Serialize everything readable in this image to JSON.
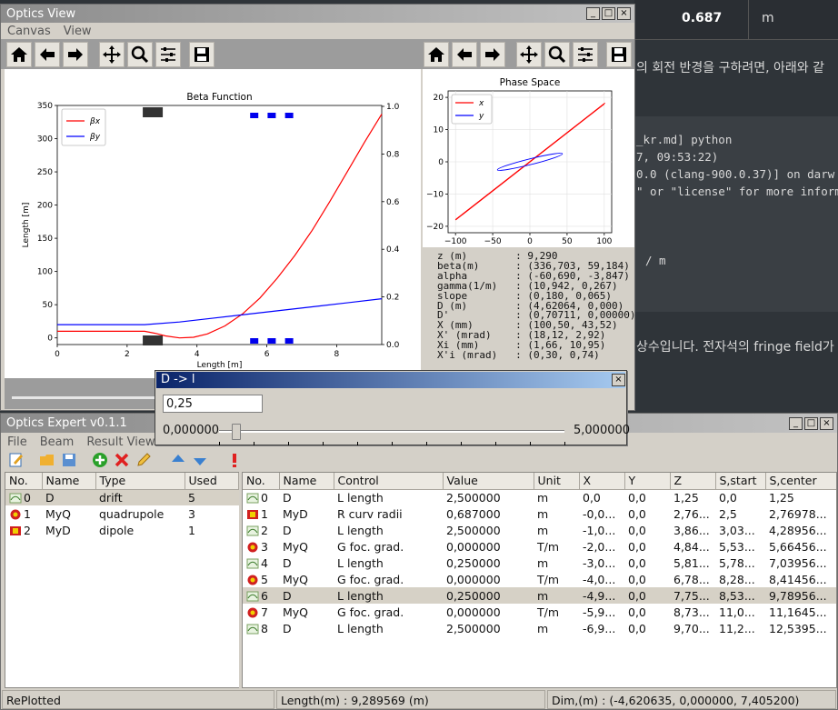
{
  "background": {
    "header_value": "0.687",
    "header_unit": "m",
    "korean_line1": "의 회전 반경을 구하려면, 아래와 같",
    "code_lines": [
      "_kr.md] python",
      "7, 09:53:22)",
      "0.0 (clang-900.0.37)] on darw",
      "\" or \"license\" for more inform"
    ],
    "unit_line": "/ m",
    "korean_line2": "상수입니다. 전자석의 fringe field가"
  },
  "optics_view": {
    "title": "Optics View",
    "menu": [
      "Canvas",
      "View"
    ],
    "beta_chart": {
      "title": "Beta Function",
      "xlabel": "Length [m]",
      "ylabel": "Length [m]",
      "legend": [
        "βx",
        "βy"
      ],
      "x_ticks": [
        "0",
        "2",
        "4",
        "6",
        "8"
      ],
      "y_ticks": [
        "0",
        "50",
        "100",
        "150",
        "200",
        "250",
        "300",
        "350"
      ],
      "y2_ticks": [
        "0.0",
        "0.2",
        "0.4",
        "0.6",
        "0.8",
        "1.0"
      ]
    },
    "phase_chart": {
      "title": "Phase Space",
      "legend": [
        "x",
        "y"
      ],
      "x_ticks": [
        "−100",
        "−50",
        "0",
        "50",
        "100"
      ],
      "y_ticks": [
        "−20",
        "−10",
        "0",
        "10",
        "20"
      ]
    },
    "info_lines": [
      "z (m)        : 9,290",
      "beta(m)      : (336,703, 59,184)",
      "alpha        : (-60,690, -3,847)",
      "gamma(1/m)   : (10,942, 0,267)",
      "slope        : (0,180, 0,065)",
      "D (m)        : (4,62064, 0,000)",
      "D'           : (0,70711, 0,00000)",
      "X (mm)       : (100,50, 43,52)",
      "X' (mrad)    : (18,12, 2,92)",
      "Xi (mm)      : (1,66, 10,95)",
      "X'i (mrad)   : (0,30, 0,74)"
    ]
  },
  "chart_data": [
    {
      "type": "line",
      "title": "Beta Function",
      "xlabel": "Length [m]",
      "ylabel": "Length [m]",
      "xlim": [
        0,
        9.29
      ],
      "ylim": [
        -10,
        350
      ],
      "series": [
        {
          "name": "βx",
          "x": [
            0,
            1,
            2,
            2.5,
            2.8,
            3.1,
            3.5,
            3.9,
            4.3,
            4.8,
            5.3,
            5.8,
            6.3,
            6.8,
            7.3,
            7.8,
            8.3,
            8.8,
            9.29
          ],
          "y": [
            10,
            10,
            10,
            10,
            7,
            3,
            0,
            1,
            6,
            18,
            36,
            60,
            90,
            124,
            162,
            205,
            250,
            295,
            337
          ]
        },
        {
          "name": "βy",
          "x": [
            0,
            2.5,
            3.5,
            4.5,
            5.5,
            6.5,
            7.5,
            8.5,
            9.29
          ],
          "y": [
            20,
            20,
            24,
            30,
            36,
            42,
            48,
            54,
            59
          ]
        }
      ]
    },
    {
      "type": "scatter",
      "title": "Phase Space",
      "xlim": [
        -110,
        110
      ],
      "ylim": [
        -22,
        22
      ],
      "series": [
        {
          "name": "x",
          "x": [
            -100,
            -50,
            0,
            50,
            100
          ],
          "y": [
            -18,
            -9,
            0,
            9,
            18
          ]
        },
        {
          "name": "y",
          "x": [
            -45,
            -20,
            0,
            20,
            44
          ],
          "y": [
            -3,
            -1.5,
            0,
            1.5,
            3
          ]
        }
      ]
    }
  ],
  "dialog": {
    "title": "D -> l",
    "value": "0,25",
    "min_label": "0,000000",
    "max_label": "5,000000",
    "slider_fraction": 0.05
  },
  "expert": {
    "title": "Optics Expert v0.1.1",
    "menu": [
      "File",
      "Beam",
      "Result View"
    ],
    "left_headers": [
      "No.",
      "Name",
      "Type",
      "Used"
    ],
    "left_rows": [
      {
        "no": "0",
        "name": "D",
        "type": "drift",
        "used": "5",
        "icon": "drift-icon"
      },
      {
        "no": "1",
        "name": "MyQ",
        "type": "quadrupole",
        "used": "3",
        "icon": "quadrupole-icon"
      },
      {
        "no": "2",
        "name": "MyD",
        "type": "dipole",
        "used": "1",
        "icon": "dipole-icon"
      }
    ],
    "right_headers": [
      "No.",
      "Name",
      "Control",
      "Value",
      "Unit",
      "X",
      "Y",
      "Z",
      "S,start",
      "S,center"
    ],
    "right_rows": [
      {
        "no": "0",
        "name": "D",
        "control": "L length",
        "value": "2,500000",
        "unit": "m",
        "x": "0,0",
        "y": "0,0",
        "z": "1,25",
        "s_start": "0,0",
        "s_center": "1,25",
        "icon": "drift-icon"
      },
      {
        "no": "1",
        "name": "MyD",
        "control": "R curv radii",
        "value": "0,687000",
        "unit": "m",
        "x": "-0,0...",
        "y": "0,0",
        "z": "2,76...",
        "s_start": "2,5",
        "s_center": "2,76978...",
        "icon": "dipole-icon"
      },
      {
        "no": "2",
        "name": "D",
        "control": "L length",
        "value": "2,500000",
        "unit": "m",
        "x": "-1,0...",
        "y": "0,0",
        "z": "3,86...",
        "s_start": "3,03...",
        "s_center": "4,28956...",
        "icon": "drift-icon"
      },
      {
        "no": "3",
        "name": "MyQ",
        "control": "G foc. grad.",
        "value": "0,000000",
        "unit": "T/m",
        "x": "-2,0...",
        "y": "0,0",
        "z": "4,84...",
        "s_start": "5,53...",
        "s_center": "5,66456...",
        "icon": "quadrupole-icon"
      },
      {
        "no": "4",
        "name": "D",
        "control": "L length",
        "value": "0,250000",
        "unit": "m",
        "x": "-3,0...",
        "y": "0,0",
        "z": "5,81...",
        "s_start": "5,78...",
        "s_center": "7,03956...",
        "icon": "drift-icon"
      },
      {
        "no": "5",
        "name": "MyQ",
        "control": "G foc. grad.",
        "value": "0,000000",
        "unit": "T/m",
        "x": "-4,0...",
        "y": "0,0",
        "z": "6,78...",
        "s_start": "8,28...",
        "s_center": "8,41456...",
        "icon": "quadrupole-icon"
      },
      {
        "no": "6",
        "name": "D",
        "control": "L length",
        "value": "0,250000",
        "unit": "m",
        "x": "-4,9...",
        "y": "0,0",
        "z": "7,75...",
        "s_start": "8,53...",
        "s_center": "9,78956...",
        "icon": "drift-icon",
        "selected": true
      },
      {
        "no": "7",
        "name": "MyQ",
        "control": "G foc. grad.",
        "value": "0,000000",
        "unit": "T/m",
        "x": "-5,9...",
        "y": "0,0",
        "z": "8,73...",
        "s_start": "11,0...",
        "s_center": "11,1645...",
        "icon": "quadrupole-icon"
      },
      {
        "no": "8",
        "name": "D",
        "control": "L length",
        "value": "2,500000",
        "unit": "m",
        "x": "-6,9...",
        "y": "0,0",
        "z": "9,70...",
        "s_start": "11,2...",
        "s_center": "12,5395...",
        "icon": "drift-icon"
      }
    ],
    "status": {
      "left": "RePlotted",
      "middle": "Length(m) : 9,289569 (m)",
      "right": "Dim,(m) : (-4,620635, 0,000000, 7,405200)"
    }
  },
  "colors": {
    "bx": "#ff0000",
    "by": "#0000ff",
    "dialog_title": "#0a246a"
  }
}
